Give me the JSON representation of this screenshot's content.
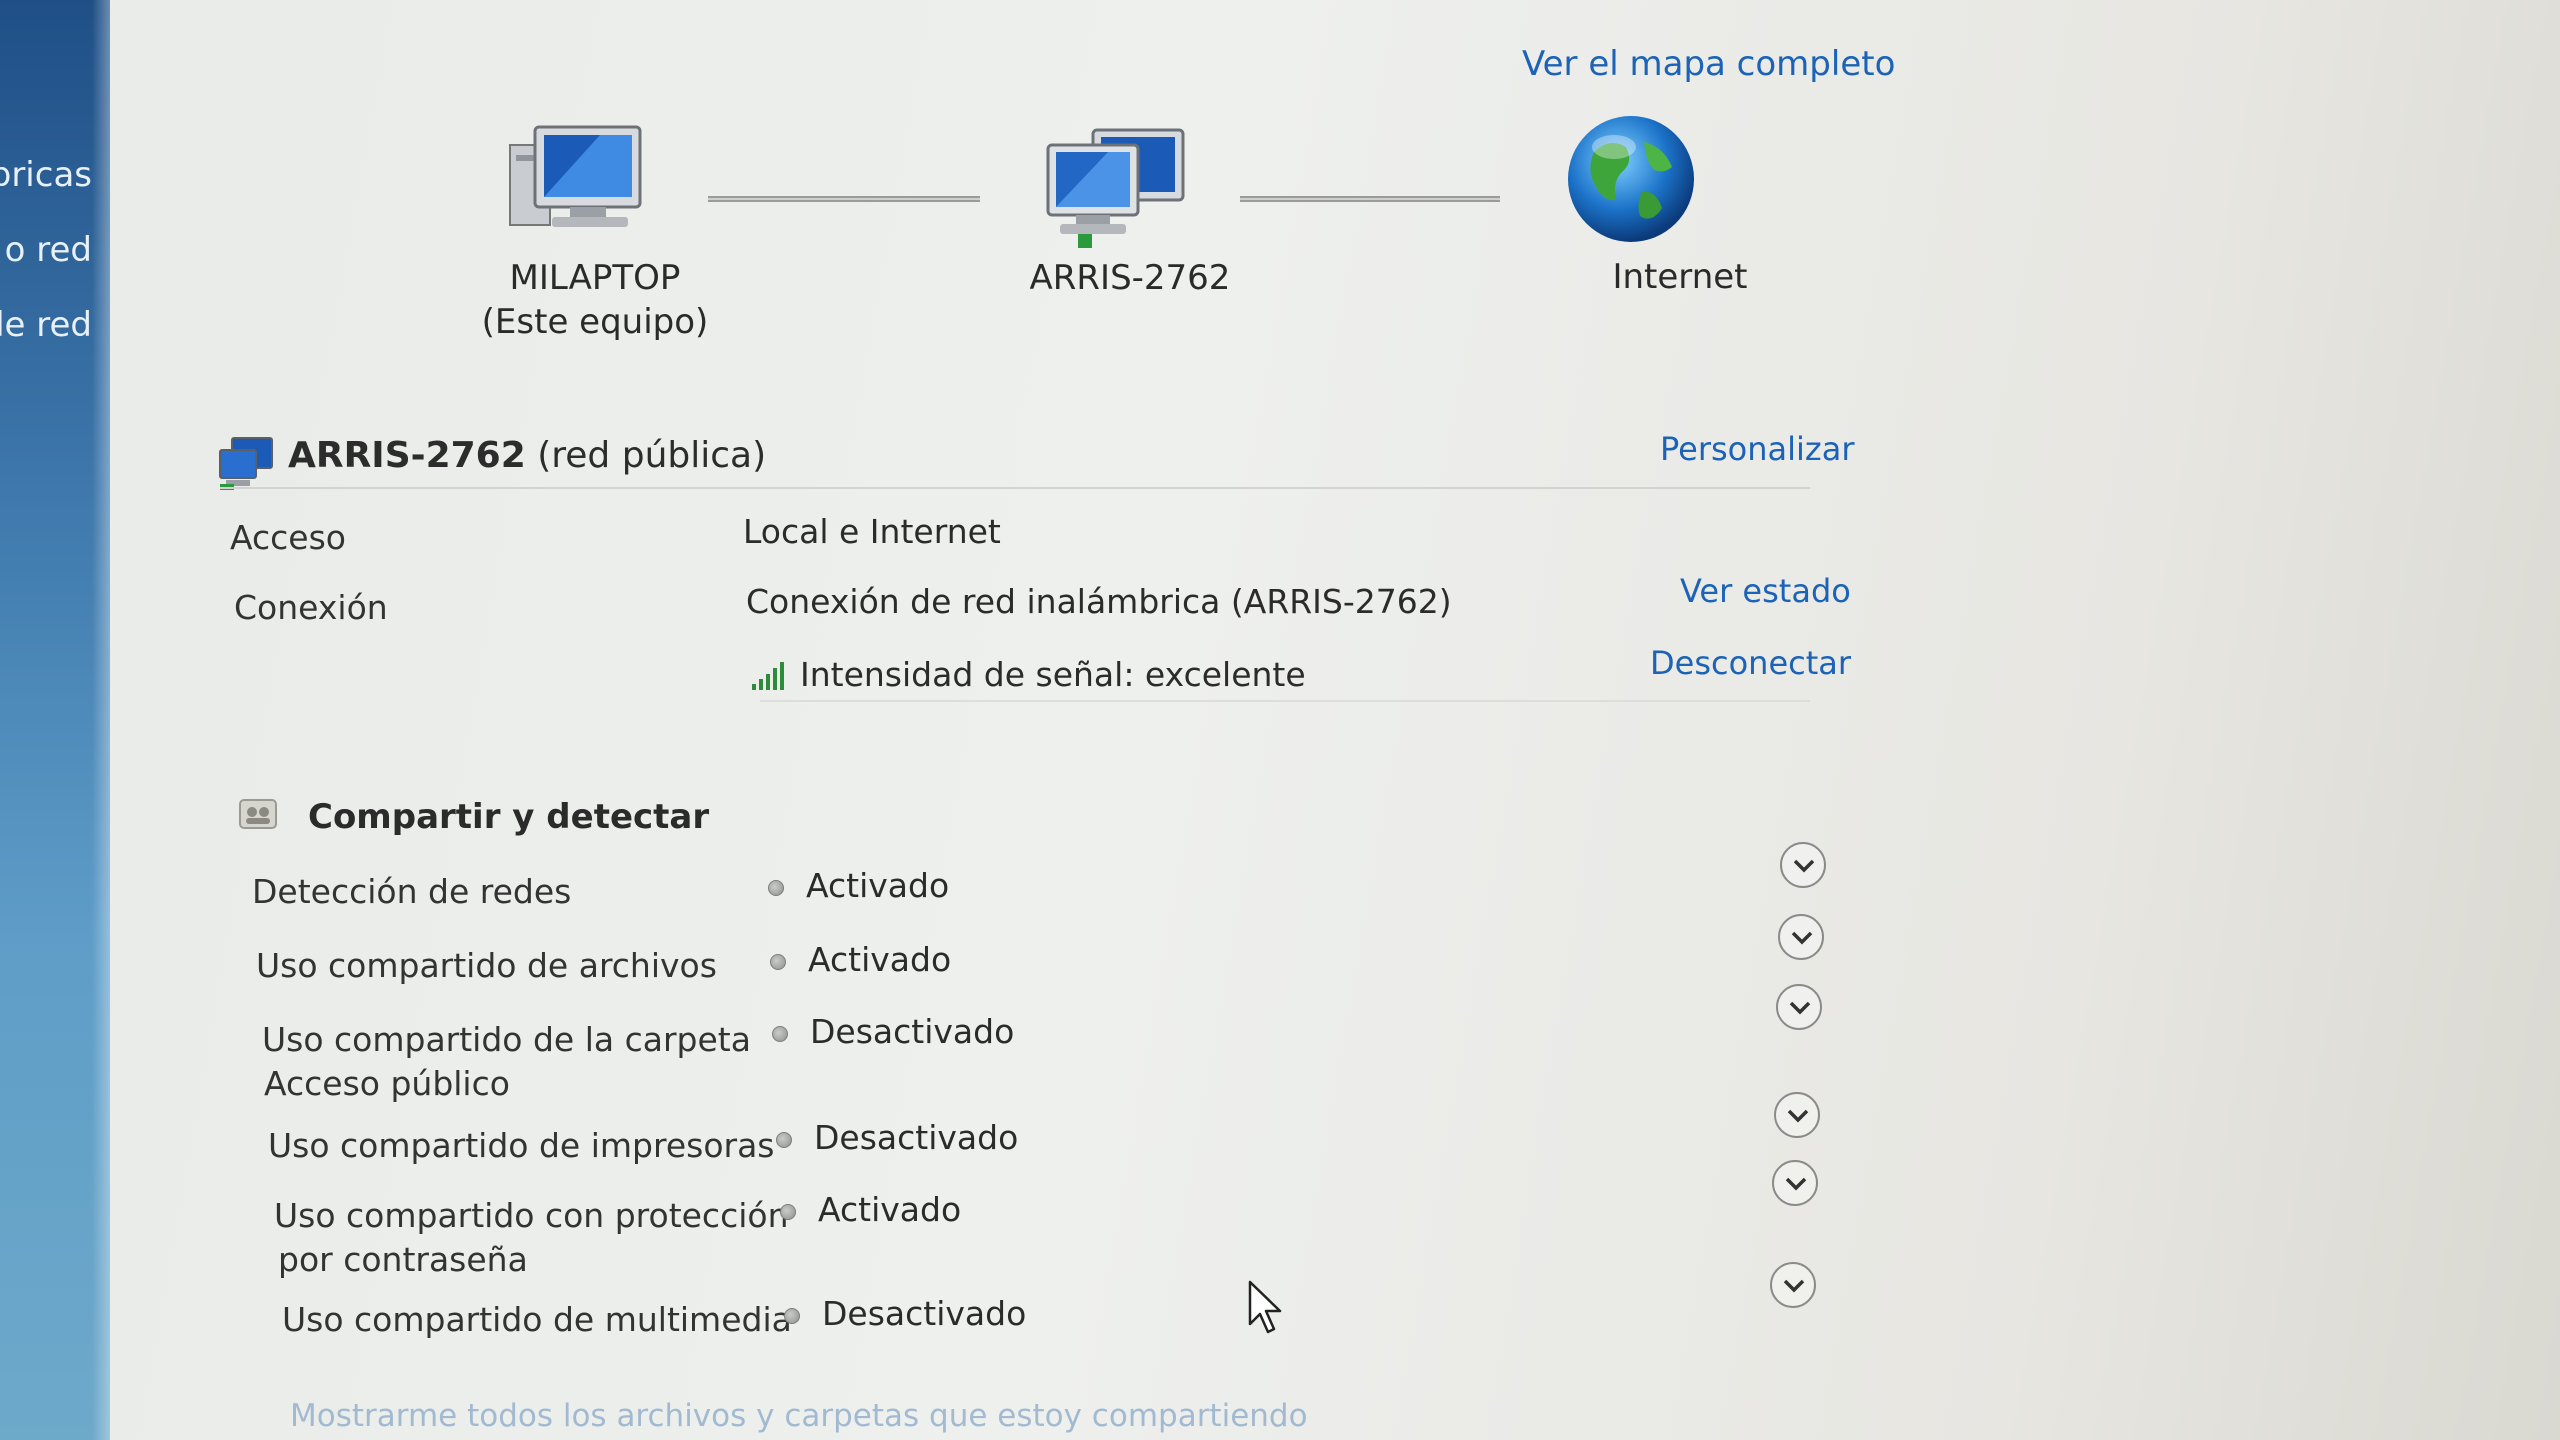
{
  "sidebar": {
    "items": [
      {
        "label": "bricas"
      },
      {
        "label": "o red"
      },
      {
        "label": "de red"
      }
    ]
  },
  "map": {
    "full_map_link": "Ver el mapa completo",
    "nodes": [
      {
        "name": "MILAPTOP",
        "sub": "(Este equipo)",
        "icon": "computer-icon"
      },
      {
        "name": "ARRIS-2762",
        "icon": "network-icon"
      },
      {
        "name": "Internet",
        "icon": "globe-icon"
      }
    ]
  },
  "network": {
    "name": "ARRIS-2762",
    "type": "(red pública)",
    "customize_link": "Personalizar",
    "rows": {
      "access_label": "Acceso",
      "access_value": "Local e Internet",
      "connection_label": "Conexión",
      "connection_value": "Conexión de red inalámbrica (ARRIS-2762)",
      "signal_value": "Intensidad de señal: excelente",
      "view_status_link": "Ver estado",
      "disconnect_link": "Desconectar"
    }
  },
  "sharing": {
    "title": "Compartir y detectar",
    "items": [
      {
        "label": "Detección de redes",
        "state": "Activado"
      },
      {
        "label": "Uso compartido de archivos",
        "state": "Activado"
      },
      {
        "label": "Uso compartido de la carpeta",
        "label2": "Acceso público",
        "state": "Desactivado"
      },
      {
        "label": "Uso compartido de impresoras",
        "state": "Desactivado"
      },
      {
        "label": "Uso compartido con protección",
        "label2": "por contraseña",
        "state": "Activado"
      },
      {
        "label": "Uso compartido de multimedia",
        "state": "Desactivado"
      }
    ],
    "footer_text": "Mostrarme todos los archivos y carpetas que estoy compartiendo"
  },
  "colors": {
    "link": "#1c63b7",
    "sidebar": "#3f79ad"
  }
}
